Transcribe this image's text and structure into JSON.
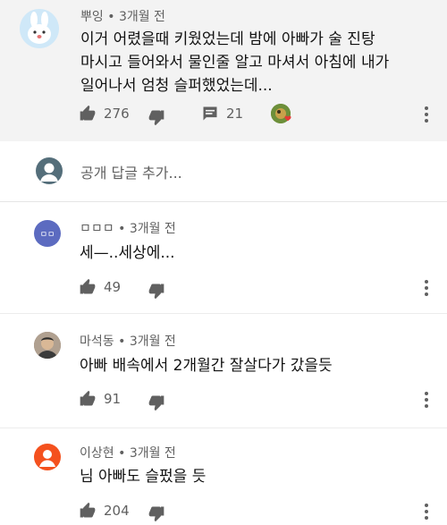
{
  "top_comment": {
    "author": "뿌잉",
    "time": "3개월 전",
    "text_lines": [
      "이거 어렸을때 키웠었는데 밤에 아빠가 술 진탕",
      "마시고 들어와서 물인줄 알고 마셔서 아침에 내가",
      "일어나서 엄청 슬퍼했었는데..."
    ],
    "likes": "276",
    "replies": "21"
  },
  "reply_box": {
    "placeholder": "공개 답글 추가..."
  },
  "replies": [
    {
      "author": "ㅁㅁㅁ",
      "time": "3개월 전",
      "text": "세—..세상에...",
      "likes": "49",
      "avatar_text": "ㅁㅁ"
    },
    {
      "author": "마석동",
      "time": "3개월 전",
      "text": "아빠 배속에서 2개월간 잘살다가 갔을듯",
      "likes": "91"
    },
    {
      "author": "이상현",
      "time": "3개월 전",
      "text": "님 아빠도 슬펐을 듯",
      "likes": "204"
    }
  ],
  "separator": "•",
  "colors": {
    "top_bg": "#f3f3f3",
    "meta_text": "#606060",
    "avatar_purple": "#5c6bc0",
    "avatar_orange": "#f4511e",
    "heart": "#e53935"
  }
}
